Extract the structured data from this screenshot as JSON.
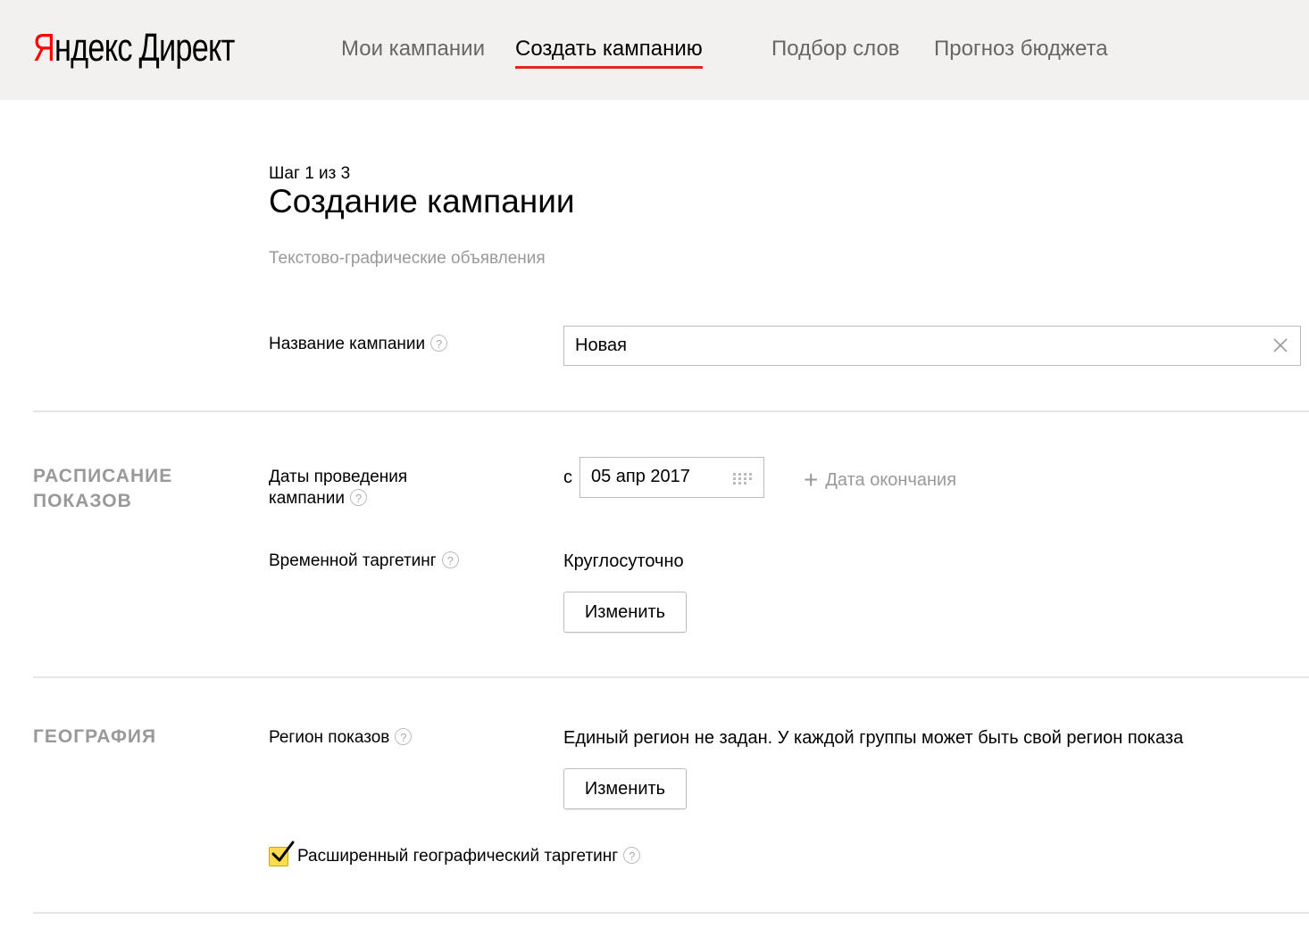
{
  "header": {
    "logo_letter": "Я",
    "logo_rest": "ндекс",
    "logo_product": "Директ",
    "nav": [
      {
        "label": "Мои кампании"
      },
      {
        "label": "Создать кампанию"
      },
      {
        "label": "Подбор слов"
      },
      {
        "label": "Прогноз бюджета"
      }
    ]
  },
  "page": {
    "step": "Шаг 1 из 3",
    "title": "Создание кампании",
    "subtitle": "Текстово-графические объявления"
  },
  "campaign_name": {
    "label": "Название кампании",
    "value": "Новая"
  },
  "schedule": {
    "section_title_line1": "РАСПИСАНИЕ",
    "section_title_line2": "ПОКАЗОВ",
    "dates_label_line1": "Даты проведения",
    "dates_label_line2": "кампании",
    "from_prefix": "с",
    "start_date": "05 апр 2017",
    "add_end_date": "Дата окончания",
    "time_targeting_label": "Временной таргетинг",
    "time_targeting_value": "Круглосуточно",
    "change_button": "Изменить"
  },
  "geography": {
    "section_title": "ГЕОГРАФИЯ",
    "region_label": "Регион показов",
    "region_value": "Единый регион не задан. У каждой группы может быть свой регион показа",
    "change_button": "Изменить",
    "extended_targeting_label": "Расширенный географический таргетинг",
    "extended_targeting_checked": true
  },
  "colors": {
    "accent_red": "#e6231e",
    "checkbox_yellow": "#ffdb4d"
  }
}
